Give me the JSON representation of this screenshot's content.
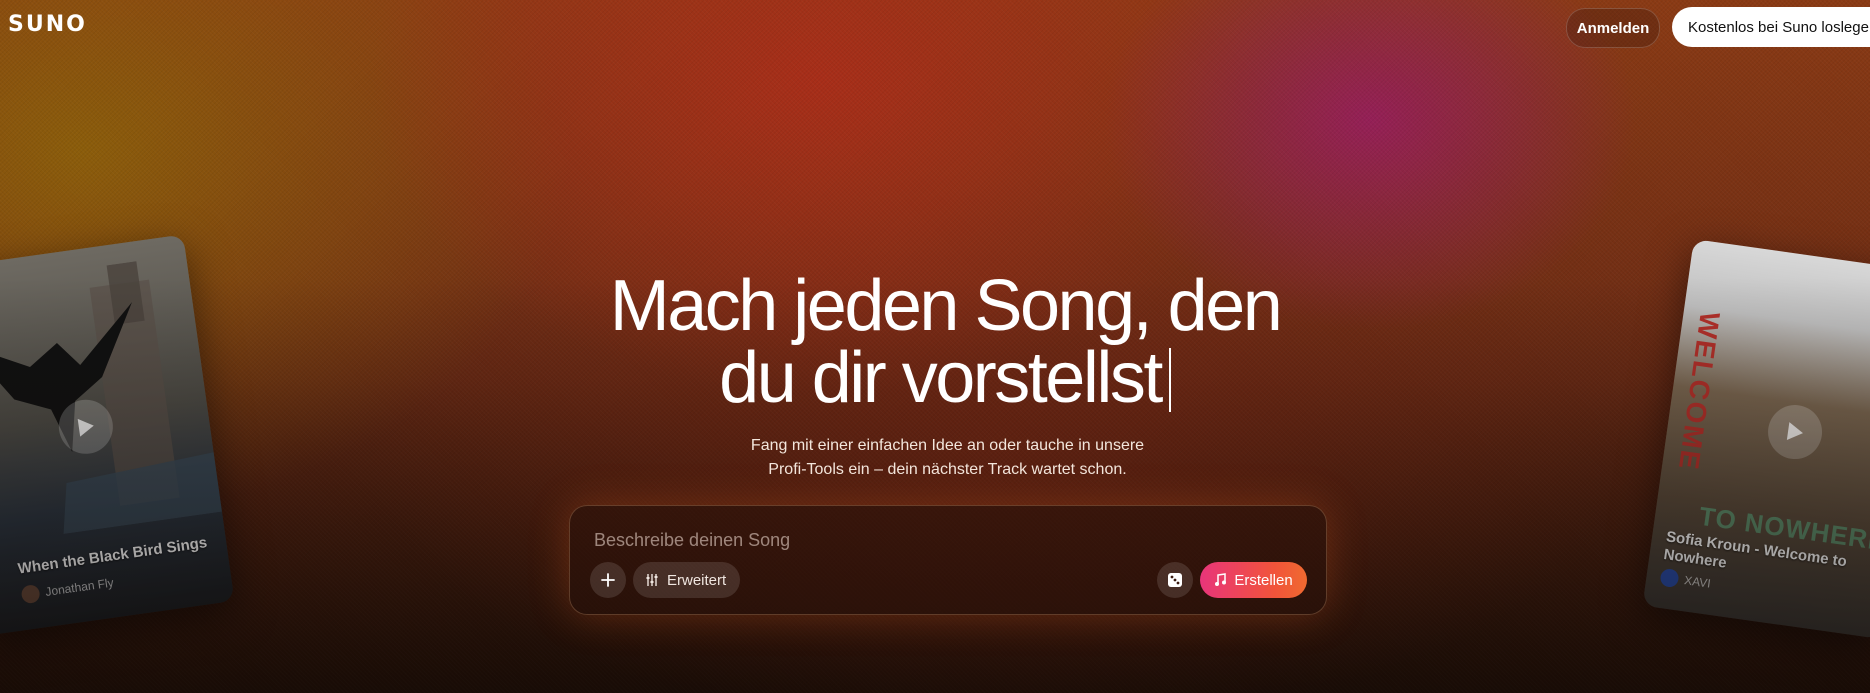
{
  "header": {
    "logo": "SUNO",
    "signin_label": "Anmelden",
    "cta_label": "Kostenlos bei Suno loslegen"
  },
  "hero": {
    "title_line1": "Mach jeden Song, den",
    "title_line2": "du dir vorstellst",
    "subtitle_line1": "Fang mit einer einfachen Idee an oder tauche in unsere",
    "subtitle_line2": "Profi-Tools ein – dein nächster Track wartet schon."
  },
  "prompt": {
    "placeholder": "Beschreibe deinen Song",
    "advanced_label": "Erweitert",
    "create_label": "Erstellen"
  },
  "cards": [
    {
      "title": "When the Black Bird Sings",
      "artist": "Jonathan Fly"
    },
    {
      "title": "Sofia Kroun - Welcome to Nowhere",
      "artist": "XAVI",
      "art_text_1": "WELCOME",
      "art_text_2": "TO NOWHERE"
    }
  ],
  "colors": {
    "create_gradient_start": "#e8357a",
    "create_gradient_end": "#f06a30"
  }
}
